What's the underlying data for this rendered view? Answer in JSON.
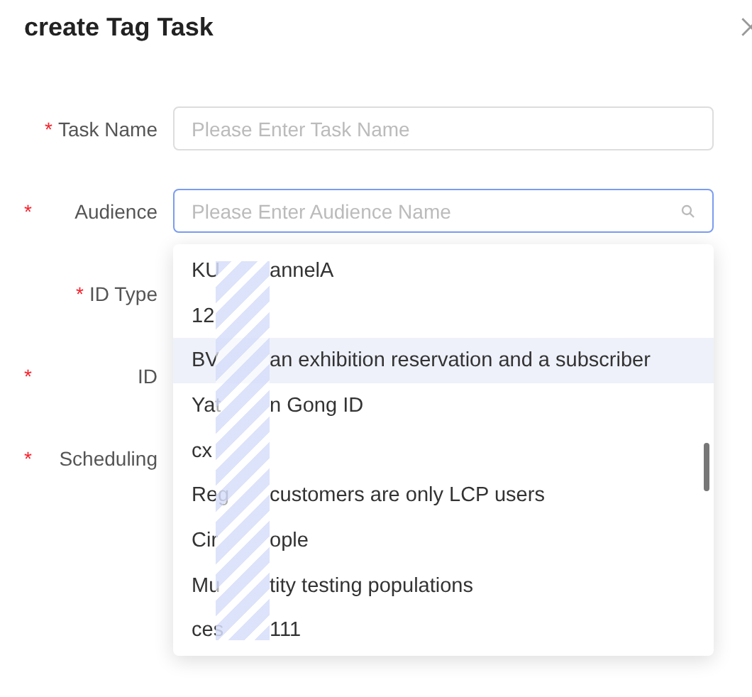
{
  "dialog": {
    "title": "create Tag Task"
  },
  "fields": [
    {
      "label": "Task Name",
      "required_mark": "*",
      "kind": "inline",
      "placeholder": "Please Enter Task Name",
      "focused": false
    },
    {
      "label": "Audience",
      "required_mark": "*",
      "kind": "left",
      "placeholder": "Please Enter Audience Name",
      "focused": true,
      "search": true
    },
    {
      "label": "ID Type",
      "required_mark": "*",
      "kind": "inline"
    },
    {
      "label": "ID",
      "required_mark": "*",
      "kind": "left"
    },
    {
      "label": "Scheduling",
      "required_mark": "*",
      "kind": "left"
    }
  ],
  "dropdown": {
    "items": [
      {
        "start": "KU",
        "end": "annelA",
        "hovered": false
      },
      {
        "start": "12",
        "hovered": false
      },
      {
        "start": "BV",
        "end": "an exhibition reservation and a subscriber",
        "hovered": true
      },
      {
        "start": "Yat",
        "end": "n Gong ID",
        "hovered": false
      },
      {
        "start": "cx",
        "hovered": false
      },
      {
        "start": "Reg",
        "end": "customers are only LCP users",
        "hovered": false
      },
      {
        "start": "Cir",
        "end": "ople",
        "hovered": false
      },
      {
        "start": "Mu",
        "end": "tity testing populations",
        "hovered": false
      },
      {
        "start": "ces",
        "end": "111",
        "hovered": false
      }
    ]
  }
}
